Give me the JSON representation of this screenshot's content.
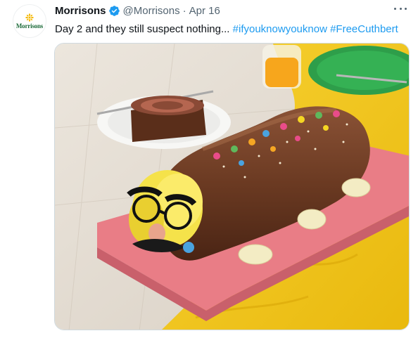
{
  "tweet": {
    "author": {
      "display_name": "Morrisons",
      "handle": "@Morrisons",
      "verified": true,
      "avatar_text": "Morrisons"
    },
    "separator": "·",
    "date": "Apr 16",
    "text_main": "Day 2 and they still suspect nothing... ",
    "hashtags": [
      "#ifyouknowyouknow",
      "#FreeCuthbert"
    ],
    "media": {
      "description_icon": "photo"
    }
  },
  "colors": {
    "link": "#1d9bf0",
    "verified": "#1d9bf0",
    "secondary_text": "#536471",
    "brand_green": "#1d6b3a",
    "brand_yellow": "#f5b800"
  }
}
